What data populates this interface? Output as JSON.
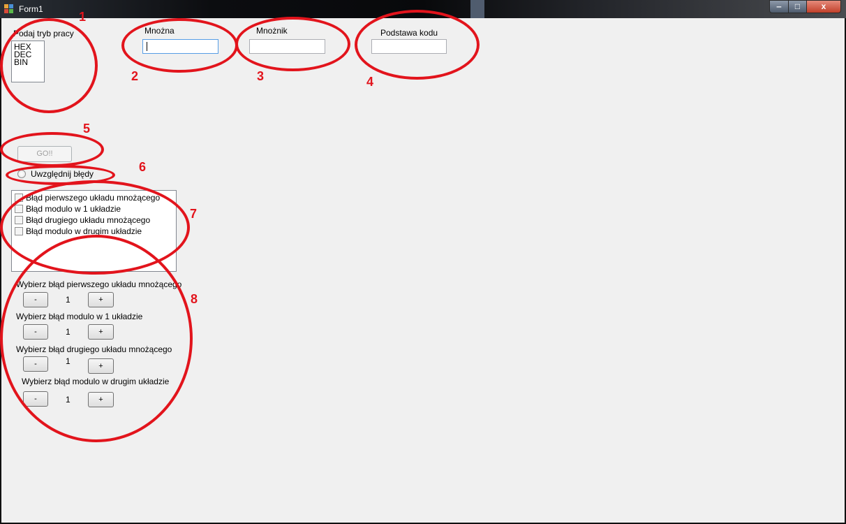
{
  "window": {
    "title": "Form1",
    "controls": {
      "minimize": "‒",
      "maximize": "□",
      "close": "x"
    }
  },
  "mode": {
    "label": "Podaj tryb pracy",
    "options": [
      "HEX",
      "DEC",
      "BIN"
    ]
  },
  "fields": {
    "mnozna_label": "Mnożna",
    "mnozna_value": "",
    "mnoznik_label": "Mnożnik",
    "mnoznik_value": "",
    "podstawa_label": "Podstawa kodu",
    "podstawa_value": ""
  },
  "go_button": "GO!!",
  "errors_radio": "Uwzględnij błędy",
  "error_checks": [
    "Błąd pierwszego układu mnożącego",
    "Błąd modulo w 1 układzie",
    "Błąd drugiego układu mnożącego",
    "Błąd modulo w drugim układzie"
  ],
  "selectors": [
    {
      "label": "Wybierz błąd pierwszego układu mnożącego",
      "value": "1",
      "minus": "-",
      "plus": "+"
    },
    {
      "label": "Wybierz błąd modulo w 1 układzie",
      "value": "1",
      "minus": "-",
      "plus": "+"
    },
    {
      "label": "Wybierz błąd drugiego układu mnożącego",
      "value": "1",
      "minus": "-",
      "plus": "+"
    },
    {
      "label": "Wybierz błąd modulo w drugim układzie",
      "value": "1",
      "minus": "-",
      "plus": "+"
    }
  ],
  "annotations": [
    "1",
    "2",
    "3",
    "4",
    "5",
    "6",
    "7",
    "8"
  ],
  "colors": {
    "annotation": "#e2141c",
    "form_background": "#f0f0f0"
  }
}
